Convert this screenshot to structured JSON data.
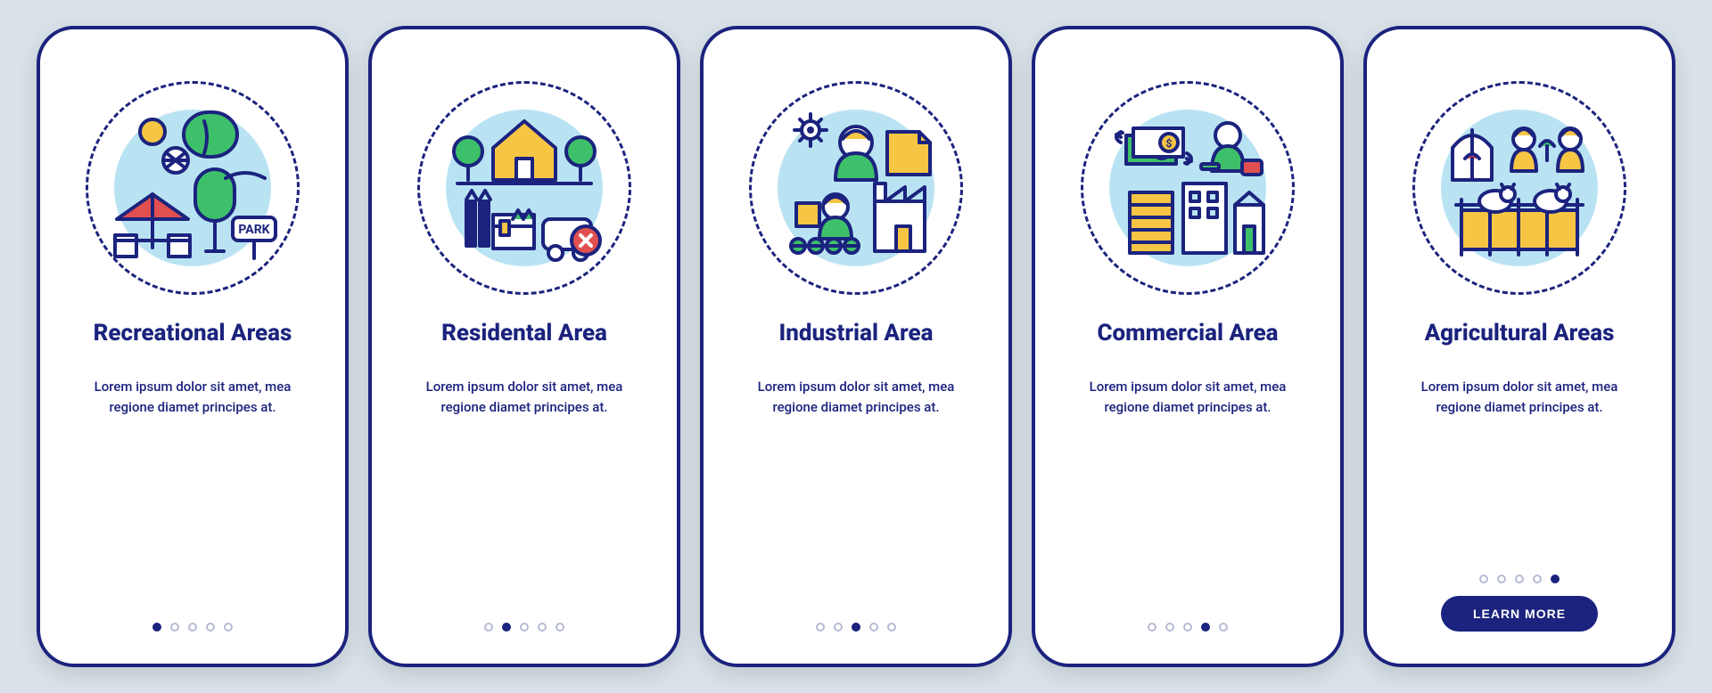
{
  "cta_label": "LEARN MORE",
  "screens": [
    {
      "title": "Recreational Areas",
      "desc": "Lorem ipsum dolor sit amet, mea regione diamet principes at.",
      "active_dot": 0,
      "show_cta": false
    },
    {
      "title": "Residental Area",
      "desc": "Lorem ipsum dolor sit amet, mea regione diamet principes at.",
      "active_dot": 1,
      "show_cta": false
    },
    {
      "title": "Industrial Area",
      "desc": "Lorem ipsum dolor sit amet, mea regione diamet principes at.",
      "active_dot": 2,
      "show_cta": false
    },
    {
      "title": "Commercial Area",
      "desc": "Lorem ipsum dolor sit amet, mea regione diamet principes at.",
      "active_dot": 3,
      "show_cta": false
    },
    {
      "title": "Agricultural Areas",
      "desc": "Lorem ipsum dolor sit amet, mea regione diamet principes at.",
      "active_dot": 4,
      "show_cta": true
    }
  ],
  "illustrations": {
    "recreational-icon": "park-umbrella-trees",
    "residential-icon": "house-no-factory",
    "industrial-icon": "workers-factory",
    "commercial-icon": "money-business-buildings",
    "agricultural-icon": "greenhouse-farmers-cows"
  },
  "colors": {
    "stroke": "#1b237e",
    "green": "#3ec06a",
    "yellow": "#f6c544",
    "red": "#e05050",
    "bg_circle": "#b9e3f3",
    "white": "#ffffff"
  }
}
